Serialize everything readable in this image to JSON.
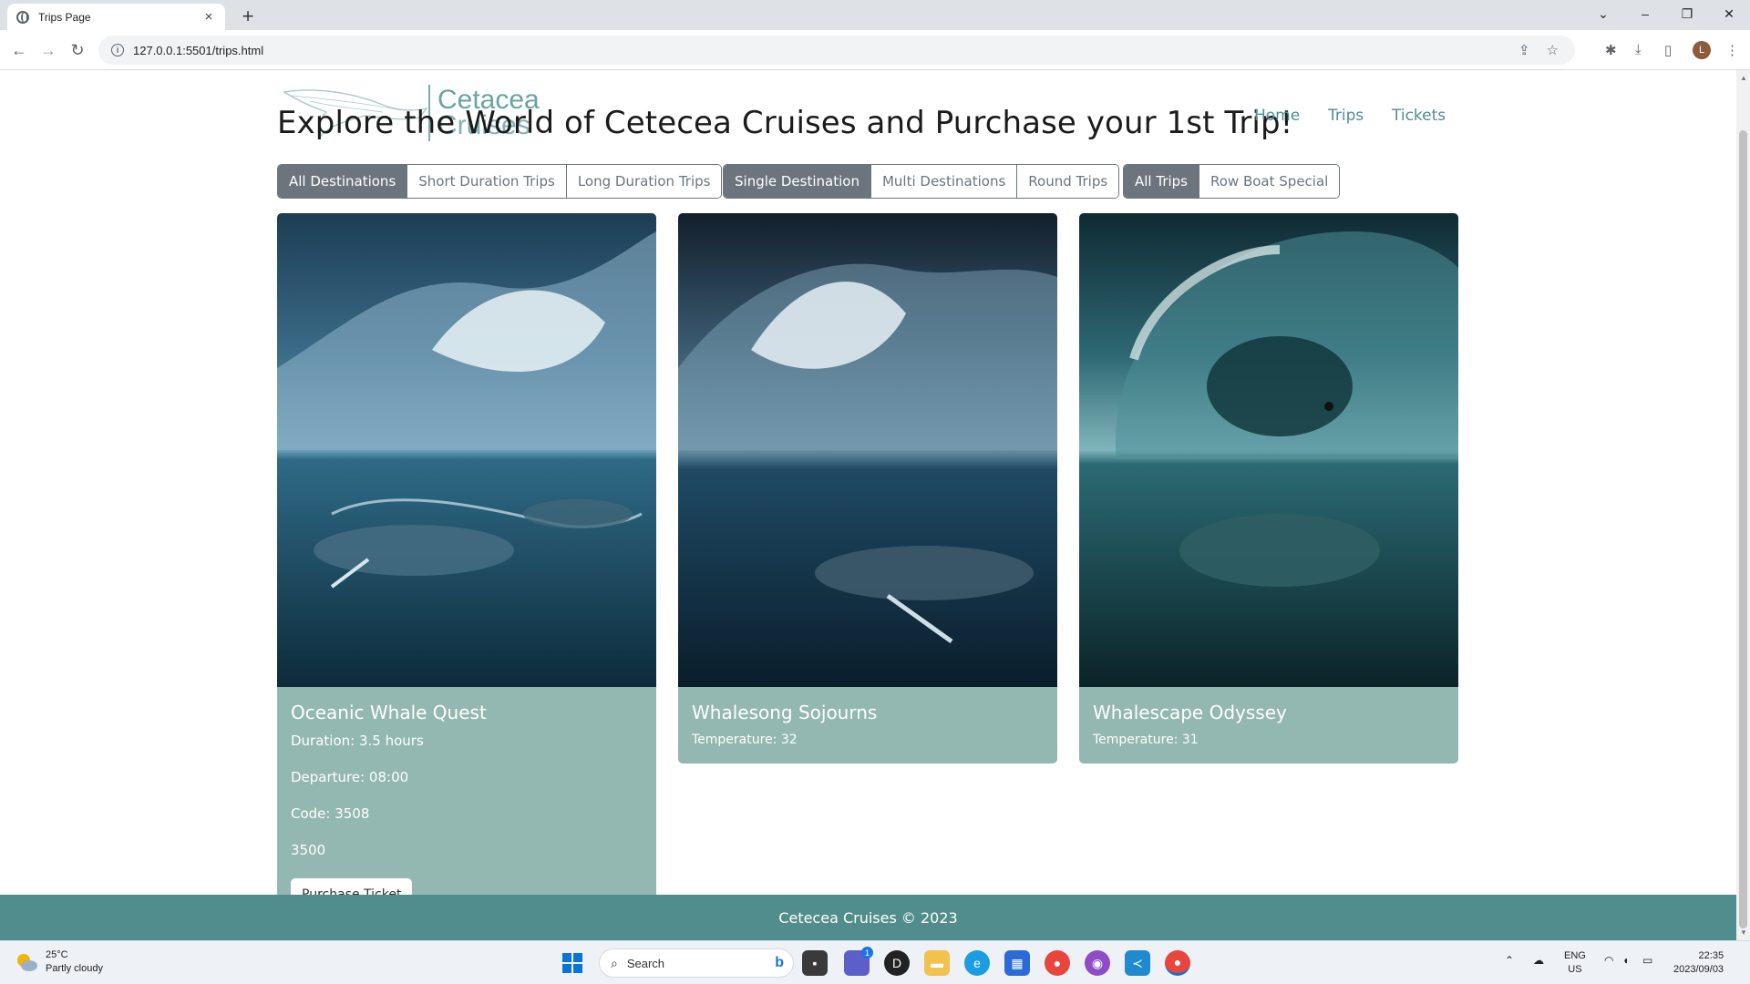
{
  "browser": {
    "tab_title": "Trips Page",
    "tab_close": "×",
    "new_tab": "+",
    "url": "127.0.0.1:5501/trips.html",
    "window_controls": [
      "⌄",
      "–",
      "❐",
      "✕"
    ]
  },
  "page": {
    "logo_line1": "Cetacea",
    "logo_line2": "Cruises",
    "heading": "Explore the World of Cetecea Cruises and Purchase your 1st Trip!",
    "nav": [
      "Home",
      "Trips",
      "Tickets"
    ],
    "filter_groups": [
      {
        "buttons": [
          {
            "label": "All Destinations",
            "active": true
          },
          {
            "label": "Short Duration Trips",
            "active": false
          },
          {
            "label": "Long Duration Trips",
            "active": false
          }
        ]
      },
      {
        "buttons": [
          {
            "label": "Single Destination",
            "active": true
          },
          {
            "label": "Multi Destinations",
            "active": false
          },
          {
            "label": "Round Trips",
            "active": false
          }
        ]
      },
      {
        "buttons": [
          {
            "label": "All Trips",
            "active": true
          },
          {
            "label": "Row Boat Special",
            "active": false
          }
        ]
      }
    ],
    "cards": [
      {
        "title": "Oceanic Whale Quest",
        "lines": [
          "Duration: 3.5 hours",
          "Departure: 08:00",
          "Code: 3508",
          "3500"
        ],
        "button": "Purchase Ticket"
      },
      {
        "title": "Whalesong Sojourns",
        "lines": [
          "Temperature: 32"
        ]
      },
      {
        "title": "Whalescape Odyssey",
        "lines": [
          "Temperature: 31"
        ]
      }
    ],
    "footer": "Cetecea Cruises © 2023"
  },
  "taskbar": {
    "temperature": "25°C",
    "weather": "Partly cloudy",
    "search": "Search",
    "lang1": "ENG",
    "lang2": "US",
    "time": "22:35",
    "date": "2023/09/03",
    "teams_badge": "1"
  },
  "colors": {
    "accent": "#528d8e",
    "card_bg": "#93b7b1",
    "button_active": "#6c757d",
    "nav_link": "#4f8f93"
  }
}
